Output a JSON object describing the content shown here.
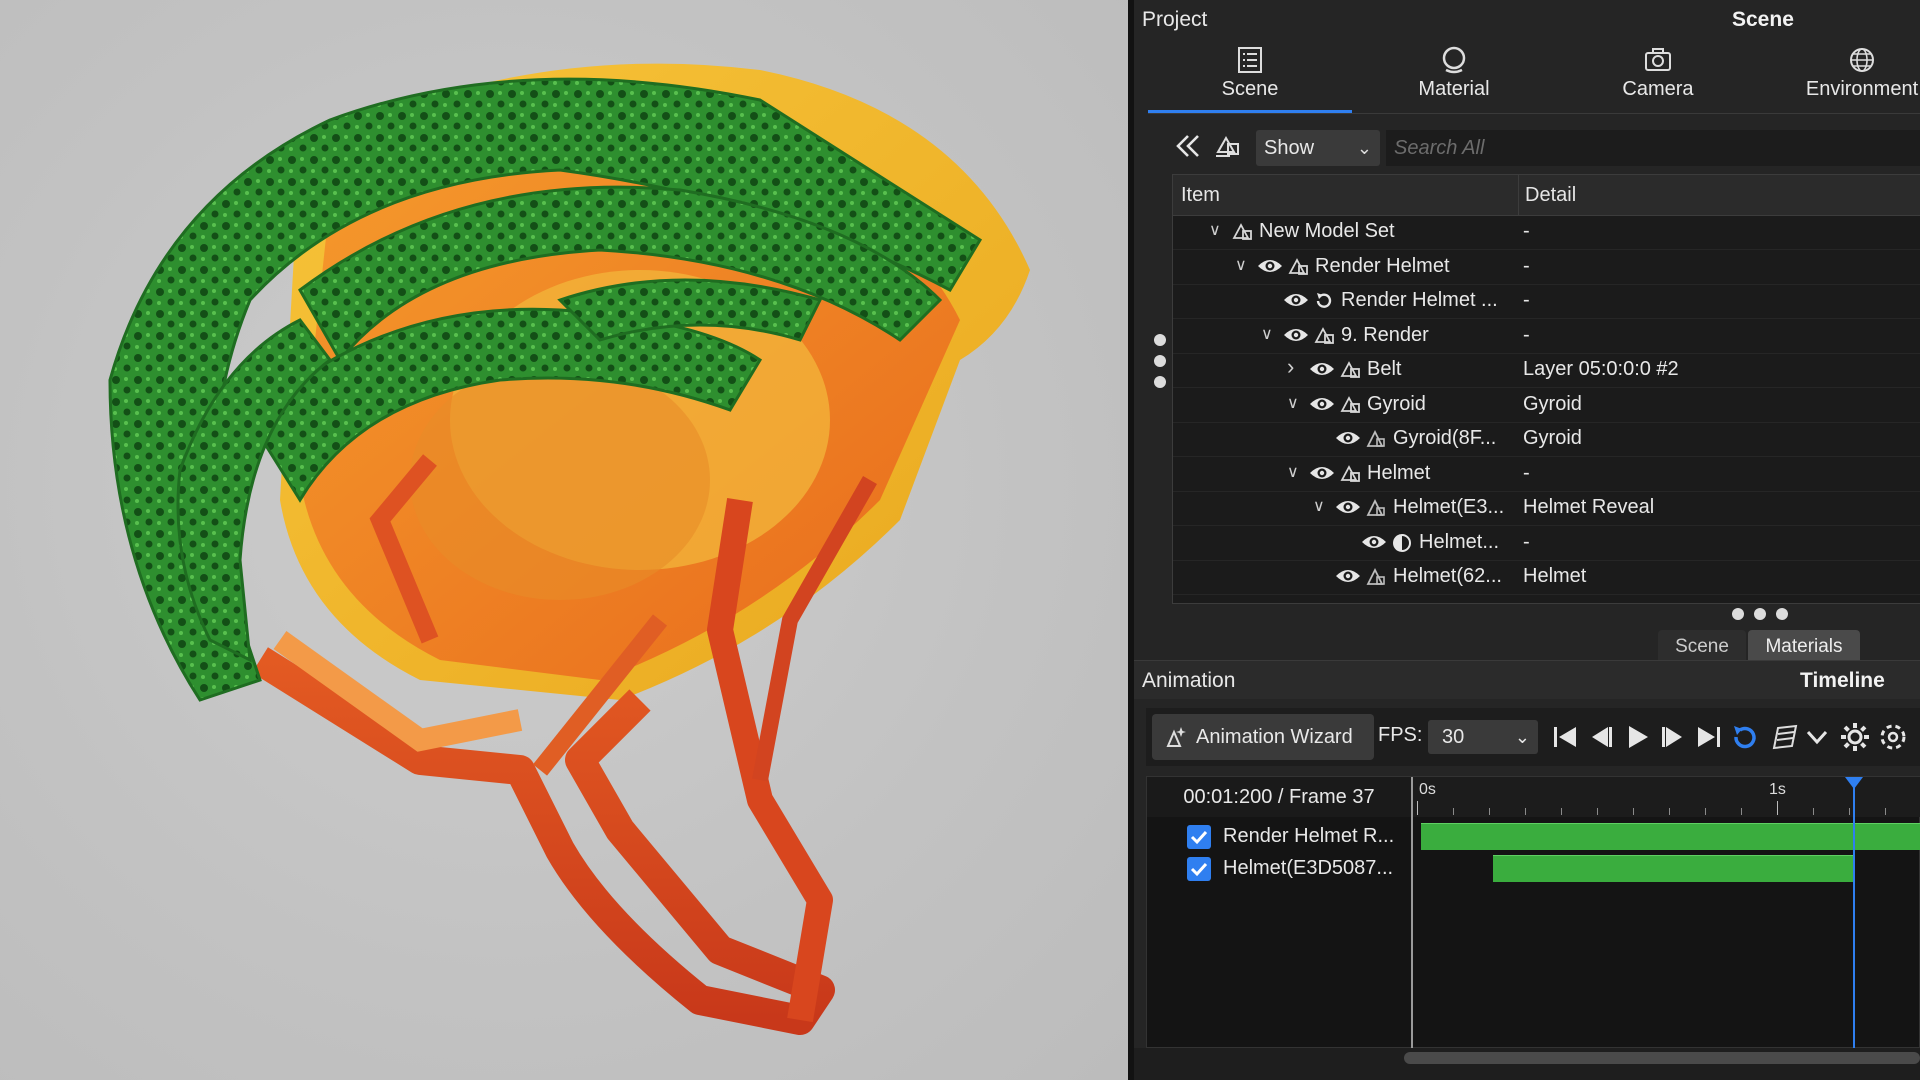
{
  "project_panel": {
    "title": "Project",
    "scene_header": "Scene",
    "tabs": [
      {
        "label": "Scene",
        "icon": "list-icon",
        "active": true
      },
      {
        "label": "Material",
        "icon": "material-sphere-icon",
        "active": false
      },
      {
        "label": "Camera",
        "icon": "camera-icon",
        "active": false
      },
      {
        "label": "Environment",
        "icon": "globe-icon",
        "active": false
      }
    ],
    "toolbar": {
      "collapse_icon": "double-chevron-left-icon",
      "model_set_icon": "model-set-icon",
      "show_select": "Show",
      "search_placeholder": "Search All"
    },
    "tree": {
      "columns": [
        "Item",
        "Detail"
      ],
      "rows": [
        {
          "name": "New Model Set",
          "detail": "-",
          "expander": "open",
          "eye": false,
          "node": "model-set-icon"
        },
        {
          "name": "Render Helmet",
          "detail": "-",
          "expander": "open",
          "eye": true,
          "node": "model-set-icon"
        },
        {
          "name": "Render Helmet ...",
          "detail": "-",
          "expander": "none",
          "eye": true,
          "node": "animation-cycle-icon"
        },
        {
          "name": "9. Render",
          "detail": "-",
          "expander": "open",
          "eye": true,
          "node": "model-set-icon"
        },
        {
          "name": "Belt",
          "detail": "Layer 05:0:0:0  #2",
          "expander": "closed",
          "eye": true,
          "node": "model-set-icon"
        },
        {
          "name": "Gyroid",
          "detail": "Gyroid",
          "expander": "open",
          "eye": true,
          "node": "model-set-icon"
        },
        {
          "name": "Gyroid(8F...",
          "detail": "Gyroid",
          "expander": "none",
          "eye": true,
          "node": "part-icon"
        },
        {
          "name": "Helmet",
          "detail": "-",
          "expander": "open",
          "eye": true,
          "node": "model-set-icon"
        },
        {
          "name": "Helmet(E3...",
          "detail": "Helmet Reveal",
          "expander": "open",
          "eye": true,
          "node": "part-icon"
        },
        {
          "name": "Helmet...",
          "detail": "-",
          "expander": "none",
          "eye": true,
          "node": "half-circle-icon"
        },
        {
          "name": "Helmet(62...",
          "detail": "Helmet",
          "expander": "none",
          "eye": true,
          "node": "part-icon"
        }
      ]
    },
    "subtabs": [
      "Scene",
      "Materials"
    ]
  },
  "animation_panel": {
    "title": "Animation",
    "timeline_header": "Timeline",
    "wizard_label": "Animation Wizard",
    "fps_label": "FPS:",
    "fps_value": "30",
    "transport_icons": [
      "skip-to-start-icon",
      "step-back-icon",
      "play-icon",
      "step-forward-icon",
      "skip-to-end-icon",
      "loop-icon",
      "keyframe-brush-icon",
      "chevron-down-icon",
      "gear-icon",
      "settings-dashed-icon"
    ],
    "time_readout": "00:01:200 / Frame 37",
    "ruler_labels": [
      "0s",
      "1s"
    ],
    "tracks": [
      {
        "name": "Render Helmet R...",
        "checked": true,
        "clip_start_s": 0.0,
        "clip_end_s": 1.45
      },
      {
        "name": "Helmet(E3D5087...",
        "checked": true,
        "clip_start_s": 0.2,
        "clip_end_s": 1.2
      }
    ],
    "playhead_s": 1.2,
    "accent_color": "#2f7ff0",
    "clip_color": "#3aad3e"
  },
  "viewport": {
    "subject": "bike-helmet-3d-model",
    "colors": {
      "lattice": "#2f9a32",
      "shell": "#f0b62a",
      "frame": "#f07a22",
      "straps": "#d3421c"
    }
  }
}
